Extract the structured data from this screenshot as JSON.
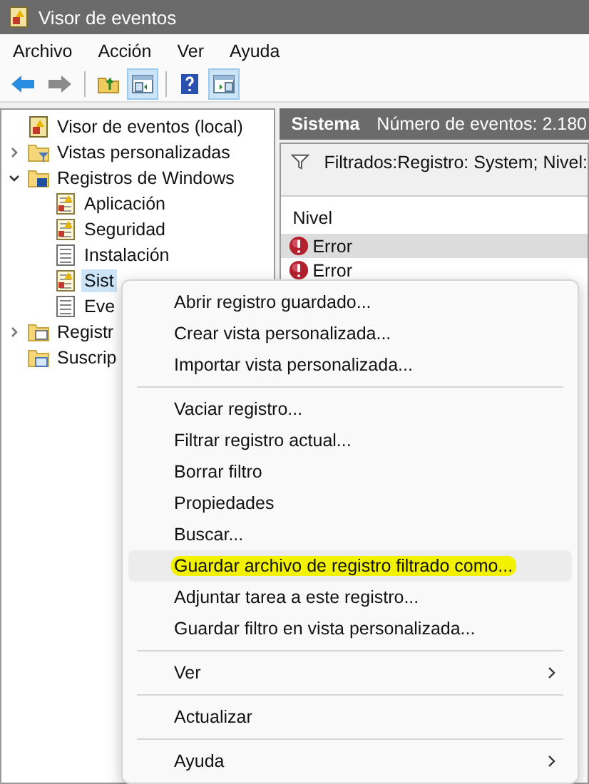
{
  "window": {
    "title": "Visor de eventos"
  },
  "menu_bar": [
    "Archivo",
    "Acción",
    "Ver",
    "Ayuda"
  ],
  "toolbar": [
    {
      "kind": "back",
      "pressed": false
    },
    {
      "kind": "forward",
      "pressed": false
    },
    {
      "kind": "separator"
    },
    {
      "kind": "up",
      "pressed": false
    },
    {
      "kind": "tree-pane",
      "pressed": true
    },
    {
      "kind": "separator"
    },
    {
      "kind": "help",
      "pressed": false
    },
    {
      "kind": "action-pane",
      "pressed": true
    }
  ],
  "tree": [
    {
      "label": "Visor de eventos (local)",
      "kind": "root",
      "selected": false,
      "children": [
        {
          "label": "Vistas personalizadas",
          "kind": "filter-folder",
          "expanded": false,
          "selected": false
        },
        {
          "label": "Registros de Windows",
          "kind": "logs-folder",
          "expanded": true,
          "selected": false,
          "children": [
            {
              "label": "Aplicación",
              "kind": "log",
              "selected": false
            },
            {
              "label": "Seguridad",
              "kind": "log",
              "selected": false
            },
            {
              "label": "Instalación",
              "kind": "plain-log",
              "selected": false
            },
            {
              "label": "Sist",
              "kind": "log",
              "selected": true
            },
            {
              "label": "Eve",
              "kind": "plain-log",
              "selected": false
            }
          ]
        },
        {
          "label": "Registr",
          "kind": "folder",
          "expanded": false,
          "selected": false
        },
        {
          "label": "Suscrip",
          "kind": "subscriptions",
          "selected": false
        }
      ]
    }
  ],
  "panel": {
    "title": "Sistema",
    "count": "Número de eventos: 2.180",
    "filter": "Filtrados:Registro: System; Nivel:",
    "column": "Nivel",
    "rows": [
      {
        "level": "Error",
        "selected": true
      },
      {
        "level": "Error",
        "selected": false
      }
    ]
  },
  "context_menu": [
    {
      "kind": "item",
      "label": "Abrir registro guardado...",
      "selected": false,
      "highlighted": false
    },
    {
      "kind": "item",
      "label": "Crear vista personalizada...",
      "selected": false,
      "highlighted": false
    },
    {
      "kind": "item",
      "label": "Importar vista personalizada...",
      "selected": false,
      "highlighted": false
    },
    {
      "kind": "separator"
    },
    {
      "kind": "item",
      "label": "Vaciar registro...",
      "selected": false,
      "highlighted": false
    },
    {
      "kind": "item",
      "label": "Filtrar registro actual...",
      "selected": false,
      "highlighted": false
    },
    {
      "kind": "item",
      "label": "Borrar filtro",
      "selected": false,
      "highlighted": false
    },
    {
      "kind": "item",
      "label": "Propiedades",
      "selected": false,
      "highlighted": false
    },
    {
      "kind": "item",
      "label": "Buscar...",
      "selected": false,
      "highlighted": false
    },
    {
      "kind": "item",
      "label": "Guardar archivo de registro filtrado como...",
      "selected": true,
      "highlighted": true
    },
    {
      "kind": "item",
      "label": "Adjuntar tarea a este registro...",
      "selected": false,
      "highlighted": false
    },
    {
      "kind": "item",
      "label": "Guardar filtro en vista personalizada...",
      "selected": false,
      "highlighted": false
    },
    {
      "kind": "separator"
    },
    {
      "kind": "submenu",
      "label": "Ver",
      "selected": false,
      "highlighted": false
    },
    {
      "kind": "separator"
    },
    {
      "kind": "item",
      "label": "Actualizar",
      "selected": false,
      "highlighted": false
    },
    {
      "kind": "separator"
    },
    {
      "kind": "submenu",
      "label": "Ayuda",
      "selected": false,
      "highlighted": false
    }
  ]
}
